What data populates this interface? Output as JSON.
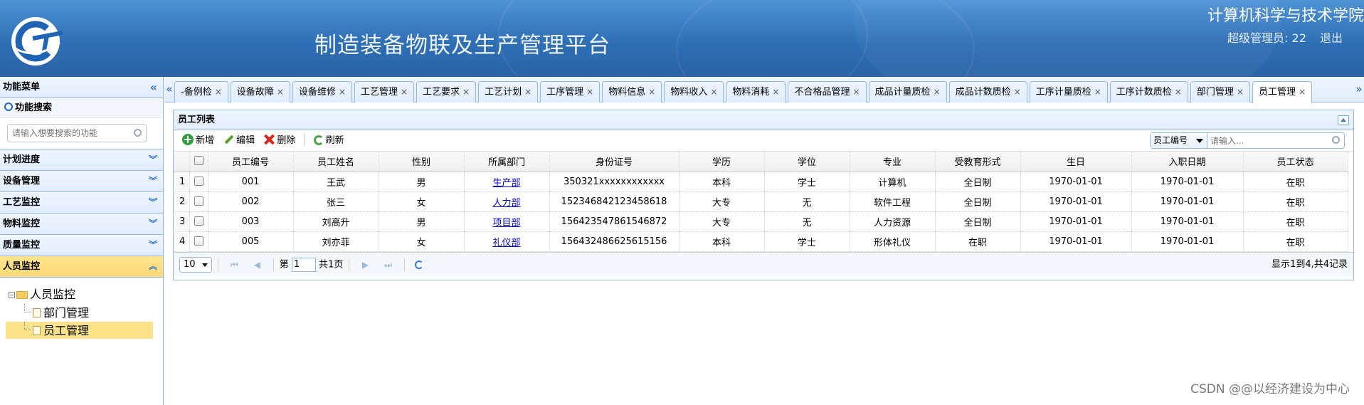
{
  "header": {
    "platform_title": "制造装备物联及生产管理平台",
    "school_name": "计算机科学与技术学院",
    "user_label": "超级管理员: 22",
    "logout": "退出",
    "colors": {
      "header_bg": "#2f6fb6"
    }
  },
  "sidebar": {
    "title": "功能菜单",
    "collapse_icon": "double-chevron-left-icon",
    "search_title": "功能搜索",
    "search_placeholder": "请输入想要搜索的功能",
    "menu": [
      {
        "label": "计划进度",
        "active": false
      },
      {
        "label": "设备管理",
        "active": false
      },
      {
        "label": "工艺监控",
        "active": false
      },
      {
        "label": "物料监控",
        "active": false
      },
      {
        "label": "质量监控",
        "active": false
      },
      {
        "label": "人员监控",
        "active": true
      }
    ],
    "tree": {
      "root": "人员监控",
      "children": [
        {
          "label": "部门管理",
          "selected": false
        },
        {
          "label": "员工管理",
          "selected": true
        }
      ]
    }
  },
  "tabs": [
    {
      "label": "-备例检",
      "active": false
    },
    {
      "label": "设备故障",
      "active": false
    },
    {
      "label": "设备维修",
      "active": false
    },
    {
      "label": "工艺管理",
      "active": false
    },
    {
      "label": "工艺要求",
      "active": false
    },
    {
      "label": "工艺计划",
      "active": false
    },
    {
      "label": "工序管理",
      "active": false
    },
    {
      "label": "物料信息",
      "active": false
    },
    {
      "label": "物料收入",
      "active": false
    },
    {
      "label": "物料消耗",
      "active": false
    },
    {
      "label": "不合格品管理",
      "active": false
    },
    {
      "label": "成品计量质检",
      "active": false
    },
    {
      "label": "成品计数质检",
      "active": false
    },
    {
      "label": "工序计量质检",
      "active": false
    },
    {
      "label": "工序计数质检",
      "active": false
    },
    {
      "label": "部门管理",
      "active": false
    },
    {
      "label": "员工管理",
      "active": true
    }
  ],
  "tab_close_symbol": "×",
  "panel": {
    "title": "员工列表",
    "toolbar": {
      "add": "新增",
      "edit": "编辑",
      "delete": "删除",
      "refresh": "刷新",
      "search_field": "员工编号",
      "search_placeholder": "请输入..."
    },
    "columns": [
      "员工编号",
      "员工姓名",
      "性别",
      "所属部门",
      "身份证号",
      "学历",
      "学位",
      "专业",
      "受教育形式",
      "生日",
      "入职日期",
      "员工状态"
    ],
    "rows": [
      {
        "rn": "1",
        "id": "001",
        "name": "王武",
        "gender": "男",
        "dept": "生产部",
        "idcard": "350321xxxxxxxxxxxx",
        "edu": "本科",
        "degree": "学士",
        "major": "计算机",
        "mode": "全日制",
        "birth": "1970-01-01",
        "join": "1970-01-01",
        "status": "在职"
      },
      {
        "rn": "2",
        "id": "002",
        "name": "张三",
        "gender": "女",
        "dept": "人力部",
        "idcard": "152346842123458618",
        "edu": "大专",
        "degree": "无",
        "major": "软件工程",
        "mode": "全日制",
        "birth": "1970-01-01",
        "join": "1970-01-01",
        "status": "在职"
      },
      {
        "rn": "3",
        "id": "003",
        "name": "刘高升",
        "gender": "男",
        "dept": "项目部",
        "idcard": "156423547861546872",
        "edu": "大专",
        "degree": "无",
        "major": "人力资源",
        "mode": "全日制",
        "birth": "1970-01-01",
        "join": "1970-01-01",
        "status": "在职"
      },
      {
        "rn": "4",
        "id": "005",
        "name": "刘亦菲",
        "gender": "女",
        "dept": "礼仪部",
        "idcard": "156432486625615156",
        "edu": "本科",
        "degree": "学士",
        "major": "形体礼仪",
        "mode": "在职",
        "birth": "1970-01-01",
        "join": "1970-01-01",
        "status": "在职"
      }
    ],
    "pager": {
      "page_size": "10",
      "page_prefix": "第",
      "page_value": "1",
      "page_suffix": "共1页",
      "info": "显示1到4,共4记录"
    }
  },
  "watermark": "CSDN @@以经济建设为中心"
}
